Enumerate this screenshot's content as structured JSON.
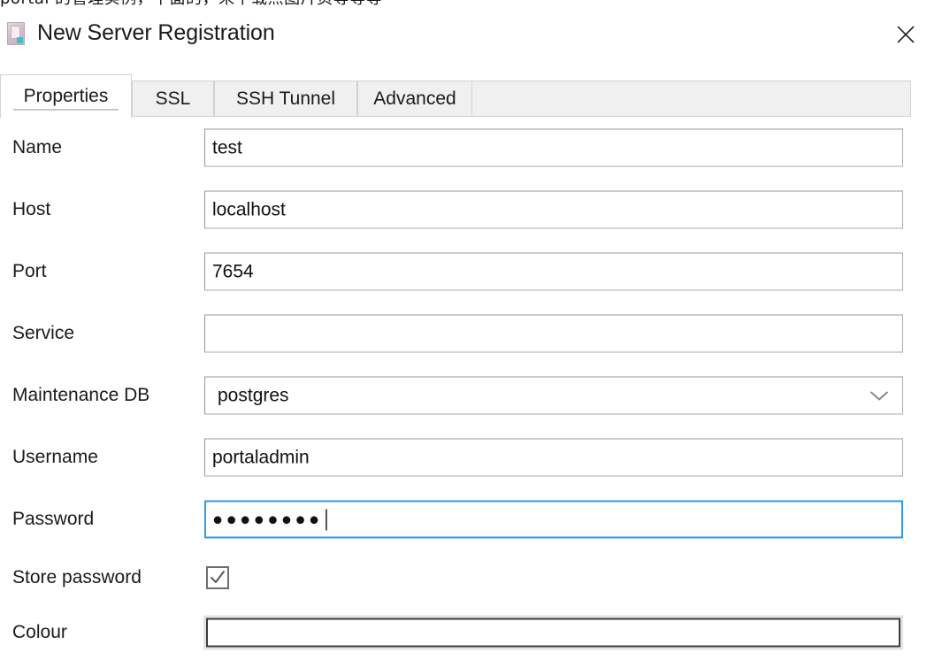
{
  "background_text": "portal 的管理实例，下面的，来下载点图片页等等等",
  "dialog": {
    "title": "New Server Registration",
    "icon": "server-icon",
    "close_icon": "close-icon"
  },
  "tabs": [
    {
      "label": "Properties",
      "active": true
    },
    {
      "label": "SSL",
      "active": false
    },
    {
      "label": "SSH Tunnel",
      "active": false
    },
    {
      "label": "Advanced",
      "active": false
    }
  ],
  "fields": {
    "name": {
      "label": "Name",
      "value": "test",
      "placeholder": ""
    },
    "host": {
      "label": "Host",
      "value": "localhost",
      "placeholder": ""
    },
    "port": {
      "label": "Port",
      "value": "7654",
      "placeholder": ""
    },
    "service": {
      "label": "Service",
      "value": "",
      "placeholder": ""
    },
    "maintenance_db": {
      "label": "Maintenance DB",
      "value": "postgres",
      "arrow_icon": "chevron-down-icon"
    },
    "username": {
      "label": "Username",
      "value": "portaladmin",
      "placeholder": ""
    },
    "password": {
      "label": "Password",
      "value": "●●●●●●●●",
      "focused": true,
      "char_count": 8
    },
    "store_password": {
      "label": "Store password",
      "checked": true,
      "check_icon": "check-icon"
    },
    "colour": {
      "label": "Colour",
      "value": ""
    }
  },
  "colors": {
    "focus_border": "#2e9ae8",
    "field_border": "#9a9a9a",
    "tab_bar": "#f0f0f0",
    "text": "#1a1a1a"
  }
}
